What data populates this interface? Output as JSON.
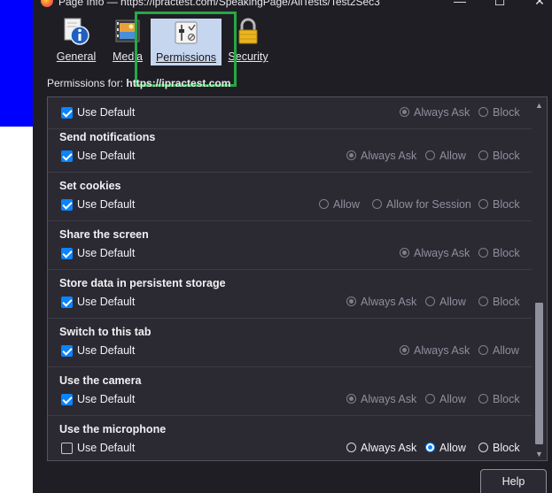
{
  "window": {
    "title": "Page Info — https://ipractest.com/SpeakingPage/AllTests/Test2Sec3",
    "controls": {
      "minimize": "—",
      "maximize": "☐",
      "close": "✕"
    }
  },
  "tabs": [
    {
      "label": "General",
      "icon": "info-icon"
    },
    {
      "label": "Media",
      "icon": "media-icon"
    },
    {
      "label": "Permissions",
      "icon": "permissions-icon",
      "selected": true
    },
    {
      "label": "Security",
      "icon": "lock-icon"
    }
  ],
  "permissions_for": {
    "label": "Permissions for:",
    "site": "https://ipractest.com"
  },
  "permissions": [
    {
      "title": "",
      "use_default": "Use Default",
      "checked": true,
      "options": [
        {
          "label": "Always Ask",
          "selected": true
        },
        {
          "label": "Block",
          "selected": false
        }
      ]
    },
    {
      "title": "Send notifications",
      "use_default": "Use Default",
      "checked": true,
      "options": [
        {
          "label": "Always Ask",
          "selected": true
        },
        {
          "label": "Allow",
          "selected": false
        },
        {
          "label": "Block",
          "selected": false
        }
      ]
    },
    {
      "title": "Set cookies",
      "use_default": "Use Default",
      "checked": true,
      "options": [
        {
          "label": "Allow",
          "selected": false
        },
        {
          "label": "Allow for Session",
          "selected": false
        },
        {
          "label": "Block",
          "selected": false
        }
      ]
    },
    {
      "title": "Share the screen",
      "use_default": "Use Default",
      "checked": true,
      "options": [
        {
          "label": "Always Ask",
          "selected": true
        },
        {
          "label": "Block",
          "selected": false
        }
      ]
    },
    {
      "title": "Store data in persistent storage",
      "use_default": "Use Default",
      "checked": true,
      "options": [
        {
          "label": "Always Ask",
          "selected": true
        },
        {
          "label": "Allow",
          "selected": false
        },
        {
          "label": "Block",
          "selected": false
        }
      ]
    },
    {
      "title": "Switch to this tab",
      "use_default": "Use Default",
      "checked": true,
      "options": [
        {
          "label": "Always Ask",
          "selected": true
        },
        {
          "label": "Allow",
          "selected": false
        }
      ]
    },
    {
      "title": "Use the camera",
      "use_default": "Use Default",
      "checked": true,
      "options": [
        {
          "label": "Always Ask",
          "selected": true
        },
        {
          "label": "Allow",
          "selected": false
        },
        {
          "label": "Block",
          "selected": false
        }
      ]
    },
    {
      "title": "Use the microphone",
      "use_default": "Use Default",
      "checked": false,
      "options": [
        {
          "label": "Always Ask",
          "selected": false
        },
        {
          "label": "Allow",
          "selected": true
        },
        {
          "label": "Block",
          "selected": false
        }
      ]
    }
  ],
  "help_button": "Help",
  "colors": {
    "accent": "#0a84ff",
    "selected_tab": "#c6d6ef",
    "highlight_box": "#27a844",
    "background_page": "#0000ff"
  }
}
